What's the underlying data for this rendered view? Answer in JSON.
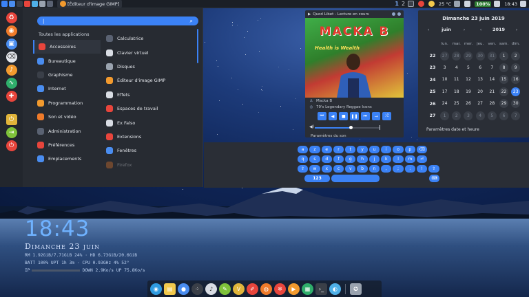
{
  "top_panel": {
    "task_label": "[Éditeur d'image GIMP]",
    "workspace_active": "1",
    "workspace_other": "2",
    "temperature": "25 °C",
    "battery": "100%",
    "clock": "18:43"
  },
  "app_menu": {
    "search": {
      "value": "|",
      "placeholder": ""
    },
    "categories_header": "Toutes les applications",
    "categories": [
      {
        "label": "Accessoires",
        "color": "#e8453c"
      },
      {
        "label": "Bureautique",
        "color": "#4a8df0"
      },
      {
        "label": "Graphisme",
        "color": "#3a3f48"
      },
      {
        "label": "Internet",
        "color": "#4a8df0"
      },
      {
        "label": "Programmation",
        "color": "#f29a2e"
      },
      {
        "label": "Son et vidéo",
        "color": "#f07b2a"
      },
      {
        "label": "Administration",
        "color": "#5a6272"
      },
      {
        "label": "Préférences",
        "color": "#e8453c"
      },
      {
        "label": "Emplacements",
        "color": "#4a8df0"
      }
    ],
    "apps": [
      {
        "label": "Calculatrice",
        "color": "#5a6272"
      },
      {
        "label": "Clavier virtuel",
        "color": "#d9dde4"
      },
      {
        "label": "Disques",
        "color": "#9aa3af"
      },
      {
        "label": "Éditeur d'image GIMP",
        "color": "#f29a2e"
      },
      {
        "label": "Effets",
        "color": "#d9dde4"
      },
      {
        "label": "Espaces de travail",
        "color": "#e8453c"
      },
      {
        "label": "Ex Falso",
        "color": "#d9dde4"
      },
      {
        "label": "Extensions",
        "color": "#e8453c"
      },
      {
        "label": "Fenêtres",
        "color": "#4a8df0"
      },
      {
        "label": "Firefox",
        "color": "#f07b2a"
      }
    ]
  },
  "player": {
    "title": "Quod Libet - Lecture en cours",
    "cover_artist": "MACKA B",
    "cover_subtitle": "Health is Wealth",
    "artist": "Macka B",
    "album": "79's Legendary Reggae Icons",
    "progress": 0.55,
    "sound_settings": "Paramètres du son"
  },
  "calendar": {
    "title": "Dimanche 23 juin 2019",
    "month": "juin",
    "year": "2019",
    "weekday_heads": [
      "lun.",
      "mar.",
      "mer.",
      "jeu.",
      "ven.",
      "sam.",
      "dim."
    ],
    "weeks": [
      {
        "week": "22",
        "days": [
          {
            "d": "27",
            "t": "other"
          },
          {
            "d": "28",
            "t": "other"
          },
          {
            "d": "29",
            "t": "other"
          },
          {
            "d": "30",
            "t": "other"
          },
          {
            "d": "31",
            "t": "other"
          },
          {
            "d": "1",
            "t": "weekend"
          },
          {
            "d": "2",
            "t": "weekend"
          }
        ]
      },
      {
        "week": "23",
        "days": [
          {
            "d": "3"
          },
          {
            "d": "4"
          },
          {
            "d": "5"
          },
          {
            "d": "6"
          },
          {
            "d": "7"
          },
          {
            "d": "8",
            "t": "weekend"
          },
          {
            "d": "9",
            "t": "weekend"
          }
        ]
      },
      {
        "week": "24",
        "days": [
          {
            "d": "10"
          },
          {
            "d": "11"
          },
          {
            "d": "12"
          },
          {
            "d": "13"
          },
          {
            "d": "14"
          },
          {
            "d": "15",
            "t": "weekend"
          },
          {
            "d": "16",
            "t": "weekend"
          }
        ]
      },
      {
        "week": "25",
        "days": [
          {
            "d": "17"
          },
          {
            "d": "18"
          },
          {
            "d": "19"
          },
          {
            "d": "20"
          },
          {
            "d": "21"
          },
          {
            "d": "22",
            "t": "weekend"
          },
          {
            "d": "23",
            "t": "today"
          }
        ]
      },
      {
        "week": "26",
        "days": [
          {
            "d": "24"
          },
          {
            "d": "25"
          },
          {
            "d": "26"
          },
          {
            "d": "27"
          },
          {
            "d": "28"
          },
          {
            "d": "29",
            "t": "weekend"
          },
          {
            "d": "30",
            "t": "weekend"
          }
        ]
      },
      {
        "week": "27",
        "days": [
          {
            "d": "1",
            "t": "other"
          },
          {
            "d": "2",
            "t": "other"
          },
          {
            "d": "3",
            "t": "other"
          },
          {
            "d": "4",
            "t": "other"
          },
          {
            "d": "5",
            "t": "other"
          },
          {
            "d": "6",
            "t": "other"
          },
          {
            "d": "7",
            "t": "other"
          }
        ]
      }
    ],
    "footer": "Paramètres date et heure"
  },
  "keyboard": {
    "row1": [
      "a",
      "z",
      "e",
      "r",
      "t",
      "y",
      "u",
      "i",
      "o",
      "p",
      "⌫"
    ],
    "row2": [
      "q",
      "s",
      "d",
      "f",
      "g",
      "h",
      "j",
      "k",
      "l",
      "m",
      "⏎"
    ],
    "row3": [
      "⇧",
      "w",
      "x",
      "c",
      "v",
      "b",
      "n",
      ",",
      ";",
      ":",
      "!",
      "⇧"
    ],
    "mode_key": "123",
    "hide_key": "⌨"
  },
  "conky": {
    "time": "18:43",
    "date": "Dimanche 23 juin",
    "line1": "RM 1.92GiB/7.71GiB  24%  ·  HD 6.73GiB/20.6GiB",
    "line2": "BATT 100%  UPT 1h 3m  ·  CPU 0.93GHz 4% 52°",
    "ip_label": "IP",
    "net": "DOWN 2.9Ko/s UP 75.8Ko/s",
    "ip_bar": 0.0
  },
  "colors": {
    "accent": "#3b82f6",
    "panel": "#272b32"
  }
}
